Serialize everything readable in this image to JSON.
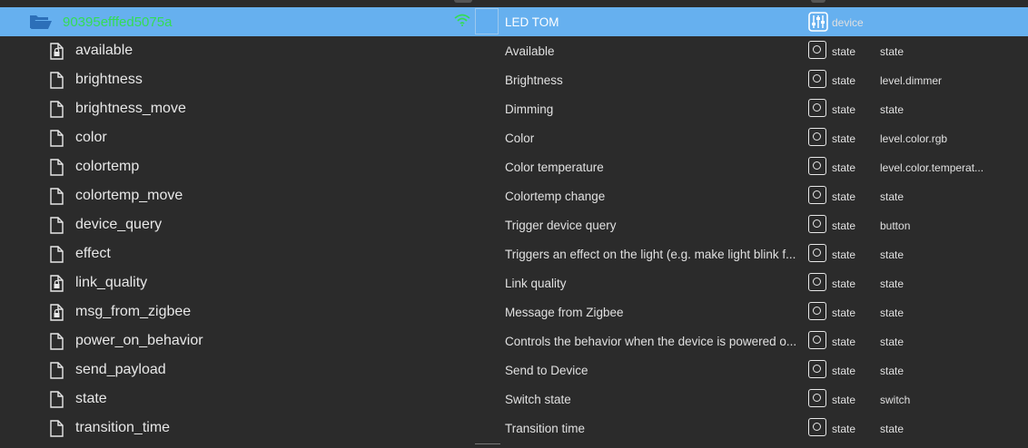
{
  "device": {
    "name": "90395efffed5075a",
    "description": "LED TOM",
    "type": "device",
    "color": "#62aef0"
  },
  "states": [
    {
      "name": "available",
      "description": "Available",
      "type": "state",
      "role": "state",
      "icon": "locked-file-icon"
    },
    {
      "name": "brightness",
      "description": "Brightness",
      "type": "state",
      "role": "level.dimmer",
      "icon": "file-icon"
    },
    {
      "name": "brightness_move",
      "description": "Dimming",
      "type": "state",
      "role": "state",
      "icon": "file-icon"
    },
    {
      "name": "color",
      "description": "Color",
      "type": "state",
      "role": "level.color.rgb",
      "icon": "file-icon"
    },
    {
      "name": "colortemp",
      "description": "Color temperature",
      "type": "state",
      "role": "level.color.temperat...",
      "icon": "file-icon"
    },
    {
      "name": "colortemp_move",
      "description": "Colortemp change",
      "type": "state",
      "role": "state",
      "icon": "file-icon"
    },
    {
      "name": "device_query",
      "description": "Trigger device query",
      "type": "state",
      "role": "button",
      "icon": "file-icon"
    },
    {
      "name": "effect",
      "description": "Triggers an effect on the light (e.g. make light blink f...",
      "type": "state",
      "role": "state",
      "icon": "file-icon"
    },
    {
      "name": "link_quality",
      "description": "Link quality",
      "type": "state",
      "role": "state",
      "icon": "locked-file-icon"
    },
    {
      "name": "msg_from_zigbee",
      "description": "Message from Zigbee",
      "type": "state",
      "role": "state",
      "icon": "locked-file-icon"
    },
    {
      "name": "power_on_behavior",
      "description": "Controls the behavior when the device is powered o...",
      "type": "state",
      "role": "state",
      "icon": "file-icon"
    },
    {
      "name": "send_payload",
      "description": "Send to Device",
      "type": "state",
      "role": "state",
      "icon": "file-icon"
    },
    {
      "name": "state",
      "description": "Switch state",
      "type": "state",
      "role": "switch",
      "icon": "file-icon"
    },
    {
      "name": "transition_time",
      "description": "Transition time",
      "type": "state",
      "role": "state",
      "icon": "file-icon"
    }
  ]
}
